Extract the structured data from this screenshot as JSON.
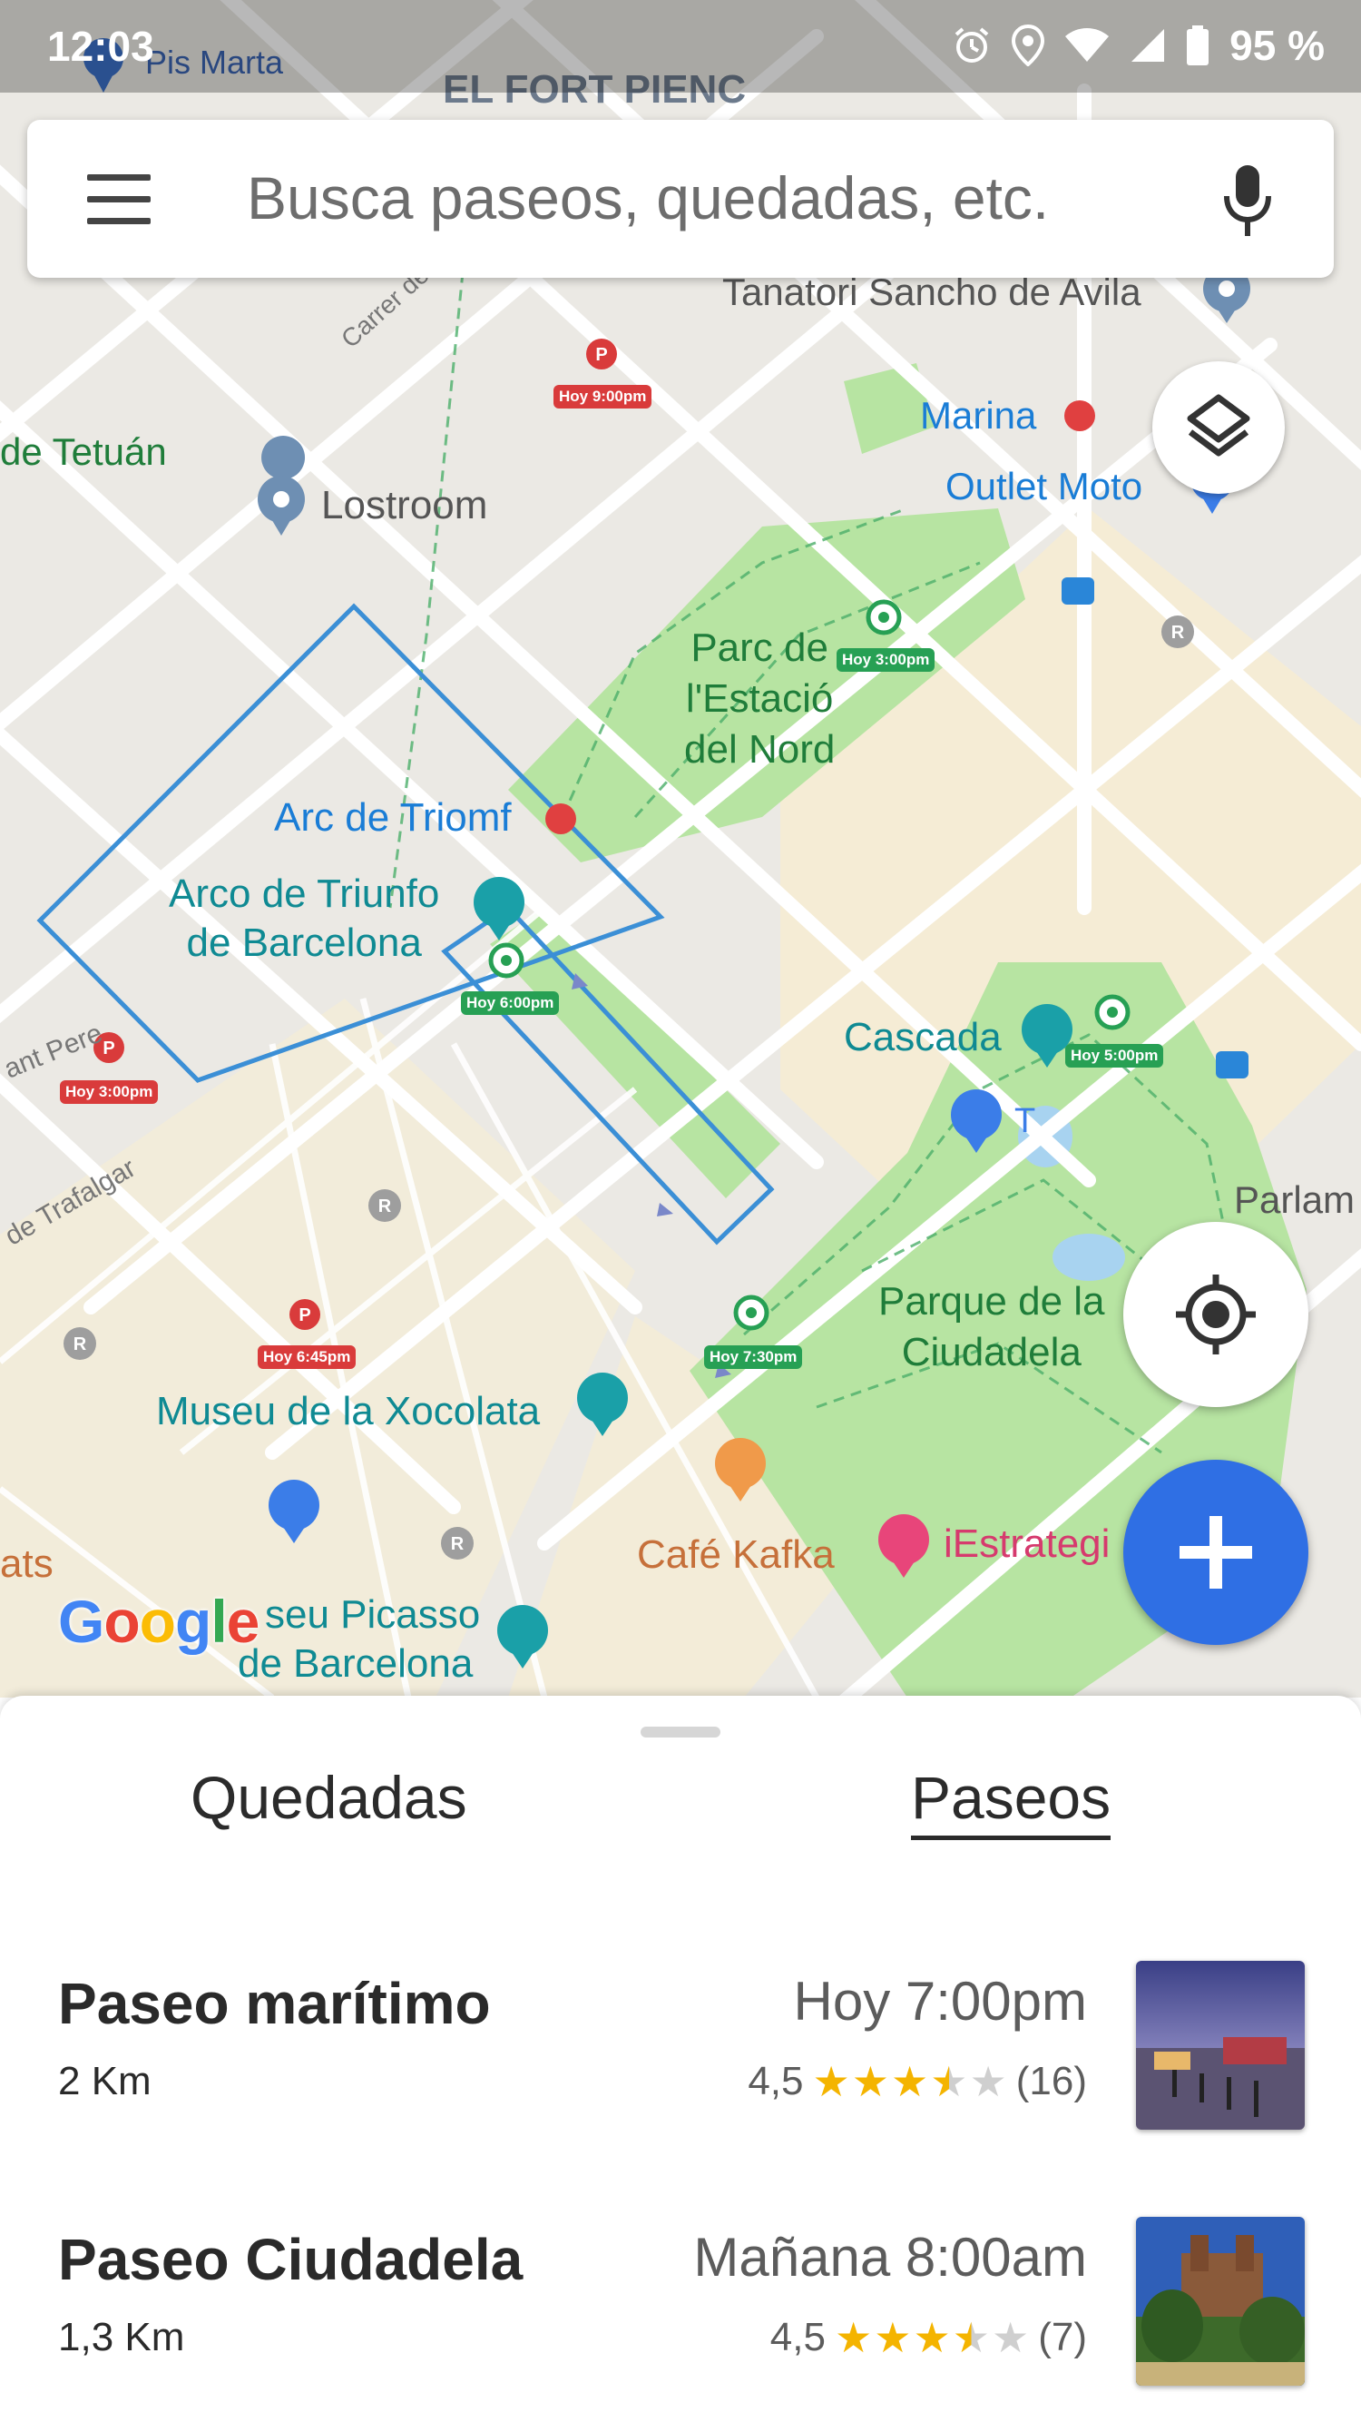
{
  "status_bar": {
    "time": "12:03",
    "battery": "95 %"
  },
  "search": {
    "placeholder": "Busca paseos, quedadas, etc."
  },
  "map": {
    "labels": {
      "el_fort_pienc": "EL FORT PIENC",
      "pis_marta": "Pis Marta",
      "tanatori": "Tanatori Sancho de Avila",
      "marina": "Marina",
      "outlet_moto": "Outlet Moto",
      "de_tetuan": "de Tetuán",
      "lostroom": "Lostroom",
      "carrer_de_cas": "Carrer de Cas",
      "parc_estacio_1": "Parc de",
      "parc_estacio_2": "l'Estació",
      "parc_estacio_3": "del Nord",
      "arc_triomf": "Arc de Triomf",
      "arco_triunfo_1": "Arco de Triunfo",
      "arco_triunfo_2": "de Barcelona",
      "ant_pere": "ant Pere",
      "de_trafalgar": "de Trafalgar",
      "cascada": "Cascada",
      "t_label": "T",
      "parlam": "Parlam",
      "parque_ciudadela_1": "Parque de la",
      "parque_ciudadela_2": "Ciudadela",
      "museu_xocolata": "Museu de la Xocolata",
      "cafe_kafka": "Café Kafka",
      "estrategi": "iEstrategi",
      "ats": "ats",
      "museu_picasso_1": "seu Picasso",
      "museu_picasso_2": "de Barcelona",
      "google": "Google"
    },
    "time_badges": {
      "b1": "Hoy 9:00pm",
      "b2": "Hoy 3:00pm",
      "b3": "Hoy 6:00pm",
      "b4": "Hoy 3:00pm",
      "b5": "Hoy 5:00pm",
      "b6": "Hoy 6:45pm",
      "b7": "Hoy 7:30pm"
    },
    "colors": {
      "route": "#3b8fd6",
      "park": "#b7e4a2",
      "quedada_pin": "#d93b3b",
      "paseo_pin": "#27a054",
      "fab_blue": "#2f6fe4"
    }
  },
  "tabs": [
    {
      "label": "Quedadas",
      "active": false
    },
    {
      "label": "Paseos",
      "active": true
    }
  ],
  "items": [
    {
      "title": "Paseo marítimo",
      "distance": "2 Km",
      "time": "Hoy 7:00pm",
      "rating": "4,5",
      "stars": 3.5,
      "reviews": "(16)"
    },
    {
      "title": "Paseo Ciudadela",
      "distance": "1,3 Km",
      "time": "Mañana 8:00am",
      "rating": "4,5",
      "stars": 3.5,
      "reviews": "(7)"
    }
  ],
  "icons": [
    "menu-icon",
    "mic-icon",
    "layers-icon",
    "my-location-icon",
    "add-icon",
    "alarm-icon",
    "location-icon",
    "wifi-icon",
    "signal-icon",
    "battery-icon"
  ]
}
